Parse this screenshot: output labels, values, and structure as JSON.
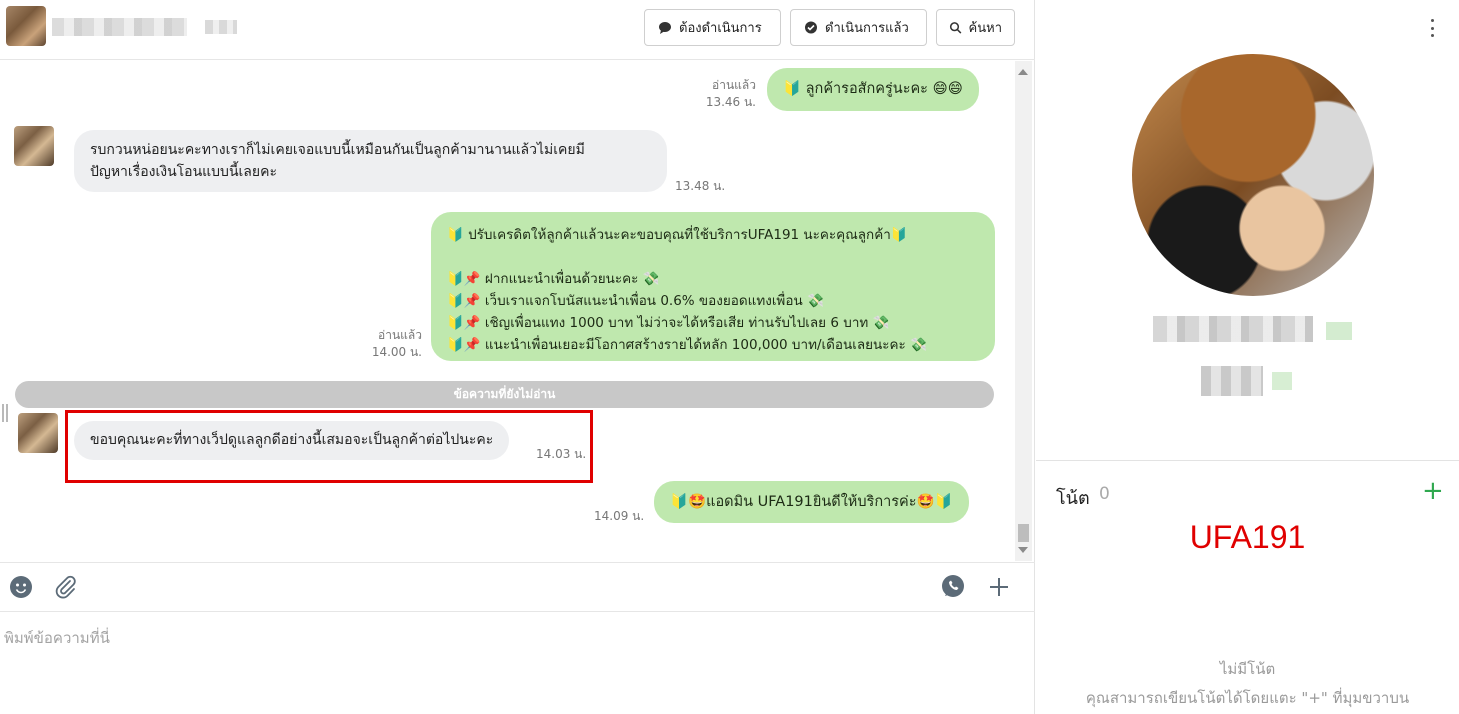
{
  "header": {
    "buttons": {
      "todo": "ต้องดำเนินการ",
      "done": "ดำเนินการแล้ว",
      "search": "ค้นหา"
    }
  },
  "messages": [
    {
      "direction": "out",
      "lines": [
        "🔰 ลูกค้ารอสักครู่นะคะ 😄😄"
      ],
      "status": "อ่านแล้ว",
      "time": "13.46 น."
    },
    {
      "direction": "in",
      "lines": [
        "รบกวนหน่อยนะคะทางเราก็ไม่เคยเจอแบบนี้เหมือนกันเป็นลูกค้ามานานแล้วไม่เคยมี",
        "ปัญหาเรื่องเงินโอนแบบนี้เลยคะ"
      ],
      "time": "13.48 น."
    },
    {
      "direction": "out",
      "lines": [
        "🔰 ปรับเครดิตให้ลูกค้าแล้วนะคะขอบคุณที่ใช้บริการUFA191 นะคะคุณลูกค้า🔰",
        "",
        "🔰📌 ฝากแนะนำเพื่อนด้วยนะคะ 💸",
        "🔰📌 เว็บเราแจกโบนัสแนะนำเพื่อน 0.6% ของยอดแทงเพื่อน 💸",
        "🔰📌 เชิญเพื่อนแทง 1000 บาท ไม่ว่าจะได้หรือเสีย ท่านรับไปเลย 6 บาท 💸",
        "🔰📌 แนะนำเพื่อนเยอะมีโอกาศสร้างรายได้หลัก 100,000 บาท/เดือนเลยนะคะ 💸"
      ],
      "status": "อ่านแล้ว",
      "time": "14.00 น."
    },
    {
      "direction": "in",
      "lines": [
        "ขอบคุณนะคะที่ทางเว็ปดูแลลูกดีอย่างนี้เสมอจะเป็นลูกค้าต่อไปนะคะ"
      ],
      "time": "14.03 น."
    },
    {
      "direction": "out",
      "lines": [
        "🔰🤩แอดมิน UFA191ยินดีให้บริการค่ะ🤩🔰"
      ],
      "time": "14.09 น."
    }
  ],
  "unread_divider": "ข้อความที่ยังไม่อ่าน",
  "composer": {
    "placeholder": "พิมพ์ข้อความที่นี่"
  },
  "notes": {
    "title": "โน้ต",
    "count": "0",
    "add_label": "+",
    "tag": "UFA191",
    "empty": "ไม่มีโน้ต",
    "help": "คุณสามารถเขียนโน้ตได้โดยแตะ \"+\" ที่มุมขวาบน"
  },
  "colors": {
    "outgoing_bubble": "#bfe8ae",
    "incoming_bubble": "#eeeff1",
    "highlight": "#e00000",
    "accent_green": "#2fa84f"
  }
}
